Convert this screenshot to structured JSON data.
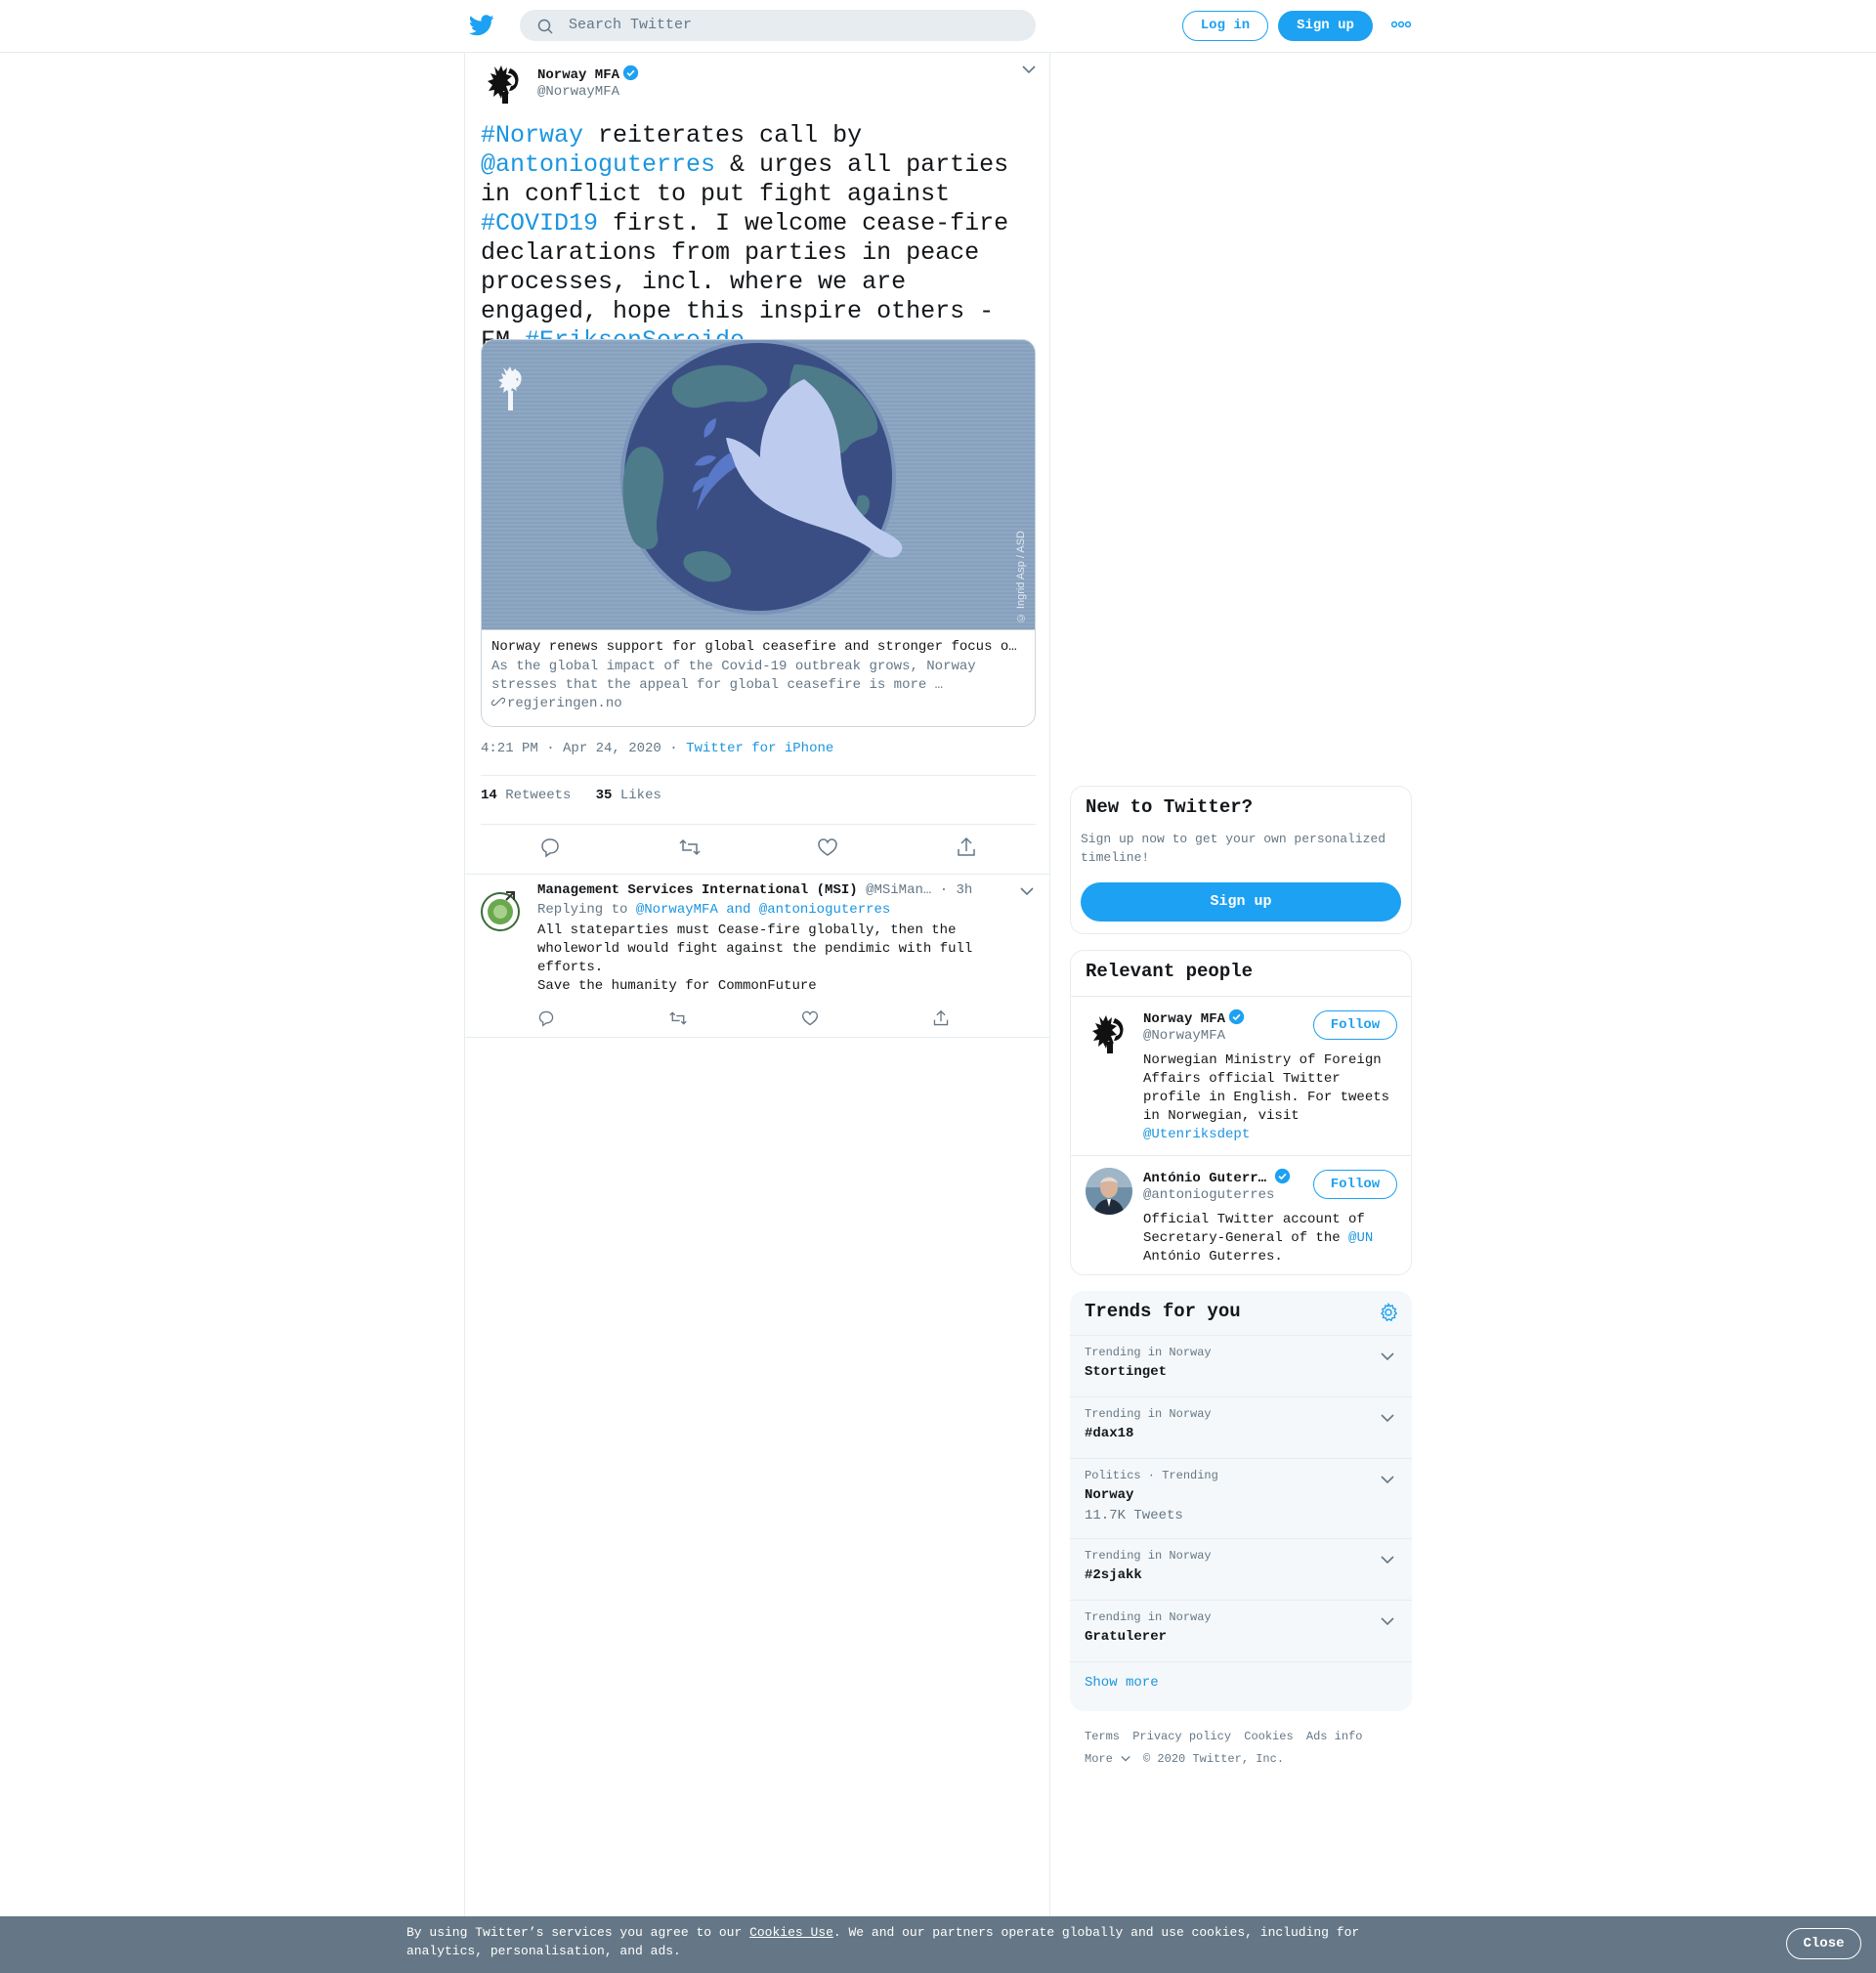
{
  "header": {
    "search_placeholder": "Search Twitter",
    "login_label": "Log in",
    "signup_label": "Sign up",
    "more_icon": "more-dots-icon"
  },
  "tweet": {
    "author_name": "Norway MFA",
    "author_handle": "@NorwayMFA",
    "text": {
      "p1": "#Norway",
      "p2": " reiterates call by ",
      "p3": "@antonioguterres",
      "p4": " & urges all parties in conflict to put fight against ",
      "p5": "#COVID19",
      "p6": " first. I welcome cease-fire declarations from parties in peace processes, incl. where we are engaged, hope this inspire others - FM ",
      "p7": "#EriksenSoreide"
    },
    "card": {
      "image_credit": "© Ingrid Asp / ASD",
      "title": "Norway renews support for global ceasefire and stronger focus on peace efforts",
      "description": "As the global impact of the Covid-19 outbreak grows, Norway stresses that the appeal for global ceasefire is more …",
      "domain": "regjeringen.no"
    },
    "timestamp": "4:21 PM · Apr 24, 2020",
    "dot": " · ",
    "source": "Twitter for iPhone",
    "retweets_count": "14",
    "retweets_label": "Retweets",
    "likes_count": "35",
    "likes_label": "Likes"
  },
  "reply": {
    "author_name": "Management Services International (MSI)",
    "author_handle": "@MSiMan…",
    "time": "· 3h",
    "replying_label": "Replying to",
    "replying_to_1": "@NorwayMFA",
    "replying_and": "and",
    "replying_to_2": "@antonioguterres",
    "text": "All stateparties must Cease-fire globally, then the wholeworld would fight against the pendimic with full efforts.\nSave the humanity for CommonFuture"
  },
  "sidebar": {
    "new_to_twitter": {
      "title": "New to Twitter?",
      "subtitle": "Sign up now to get your own personalized timeline!",
      "signup_label": "Sign up"
    },
    "relevant_people": {
      "title": "Relevant people",
      "follow_label": "Follow",
      "people": [
        {
          "name": "Norway MFA",
          "handle": "@NorwayMFA",
          "bio": "Norwegian Ministry of Foreign Affairs official Twitter profile in English. For tweets in Norwegian, visit ",
          "bio_link": "@Utenriksdept"
        },
        {
          "name": "António Guterr…",
          "handle": "@antonioguterres",
          "bio_1": "Official Twitter account of Secretary-General of the ",
          "bio_link": "@UN",
          "bio_2": " António Guterres."
        }
      ]
    },
    "trends": {
      "title": "Trends for you",
      "items": [
        {
          "meta": "Trending in Norway",
          "name": "Stortinget"
        },
        {
          "meta": "Trending in Norway",
          "name": "#dax18"
        },
        {
          "meta": "Politics · Trending",
          "name": "Norway",
          "count": "11.7K Tweets"
        },
        {
          "meta": "Trending in Norway",
          "name": "#2sjakk"
        },
        {
          "meta": "Trending in Norway",
          "name": "Gratulerer"
        }
      ],
      "show_more": "Show more"
    },
    "footer": {
      "terms": "Terms",
      "privacy": "Privacy policy",
      "cookies": "Cookies",
      "ads": "Ads info",
      "more": "More",
      "copyright": "© 2020 Twitter, Inc."
    }
  },
  "cookie_bar": {
    "text_1": "By using Twitter’s services you agree to our ",
    "link": "Cookies Use",
    "text_2": ". We and our partners operate globally and use cookies, including for analytics, personalisation, and ads.",
    "close_label": "Close"
  },
  "colors": {
    "accent": "#1da1f2",
    "link": "#1b95e0",
    "muted": "#657786",
    "border": "#e6ecf0",
    "cookie_bg": "#657786"
  }
}
